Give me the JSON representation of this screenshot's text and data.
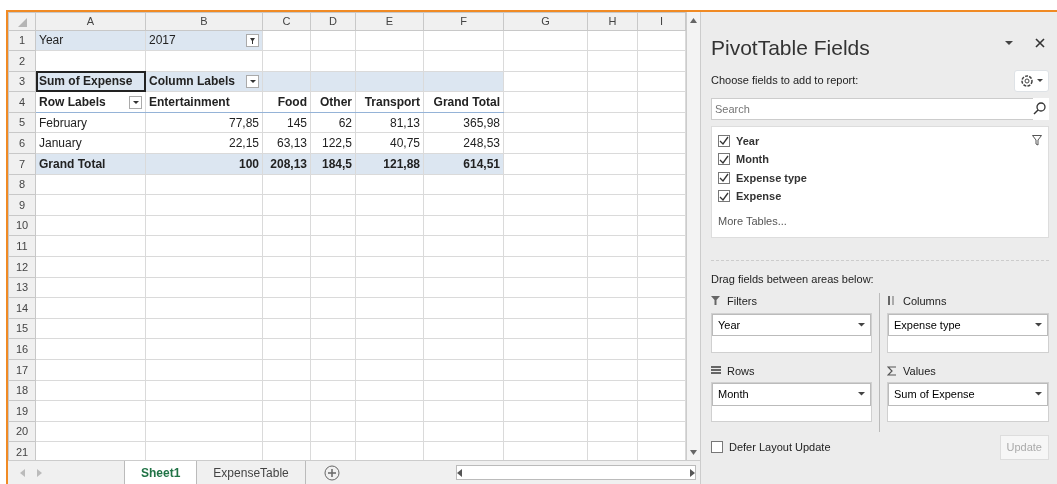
{
  "sheet": {
    "columns": [
      "A",
      "B",
      "C",
      "D",
      "E",
      "F",
      "G",
      "H",
      "I"
    ],
    "rows": [
      {
        "number": "1",
        "kind": "filter",
        "cells": [
          {
            "text": "Year",
            "selected": false
          },
          {
            "text": "2017",
            "selected": false,
            "kind": "filter-dropdown"
          }
        ]
      },
      {
        "number": "2",
        "kind": "blank"
      },
      {
        "number": "3",
        "kind": "caption",
        "cells": [
          {
            "text": "Sum of Expense",
            "selected": true
          },
          {
            "text": "Column Labels",
            "selected": false,
            "kind": "list-dropdown"
          }
        ]
      },
      {
        "number": "4",
        "kind": "header",
        "cells": [
          {
            "text": "Row Labels",
            "selected": false,
            "kind": "list-dropdown"
          },
          {
            "text": "Entertainment",
            "selected": false
          },
          {
            "text": "Food",
            "selected": false
          },
          {
            "text": "Other",
            "selected": false
          },
          {
            "text": "Transport",
            "selected": false
          },
          {
            "text": "Grand Total",
            "selected": false
          }
        ]
      },
      {
        "number": "5",
        "kind": "data",
        "cells": [
          {
            "text": "February",
            "selected": false
          },
          {
            "text": "77,85",
            "selected": false
          },
          {
            "text": "145",
            "selected": false
          },
          {
            "text": "62",
            "selected": false
          },
          {
            "text": "81,13",
            "selected": false
          },
          {
            "text": "365,98",
            "selected": false
          }
        ]
      },
      {
        "number": "6",
        "kind": "data",
        "cells": [
          {
            "text": "January",
            "selected": false
          },
          {
            "text": "22,15",
            "selected": false
          },
          {
            "text": "63,13",
            "selected": false
          },
          {
            "text": "122,5",
            "selected": false
          },
          {
            "text": "40,75",
            "selected": false
          },
          {
            "text": "248,53",
            "selected": false
          }
        ]
      },
      {
        "number": "7",
        "kind": "total",
        "cells": [
          {
            "text": "Grand Total",
            "selected": false
          },
          {
            "text": "100",
            "selected": false
          },
          {
            "text": "208,13",
            "selected": false
          },
          {
            "text": "184,5",
            "selected": false
          },
          {
            "text": "121,88",
            "selected": false
          },
          {
            "text": "614,51",
            "selected": false
          }
        ]
      },
      {
        "number": "8",
        "kind": "blank"
      },
      {
        "number": "9",
        "kind": "blank"
      },
      {
        "number": "10",
        "kind": "blank"
      },
      {
        "number": "11",
        "kind": "blank"
      },
      {
        "number": "12",
        "kind": "blank"
      },
      {
        "number": "13",
        "kind": "blank"
      },
      {
        "number": "14",
        "kind": "blank"
      },
      {
        "number": "15",
        "kind": "blank"
      },
      {
        "number": "16",
        "kind": "blank"
      },
      {
        "number": "17",
        "kind": "blank"
      },
      {
        "number": "18",
        "kind": "blank"
      },
      {
        "number": "19",
        "kind": "blank"
      },
      {
        "number": "20",
        "kind": "blank"
      },
      {
        "number": "21",
        "kind": "blank"
      }
    ],
    "tabs": [
      {
        "label": "Sheet1",
        "selected": true
      },
      {
        "label": "ExpenseTable",
        "selected": false
      }
    ]
  },
  "pane": {
    "title": "PivotTable Fields",
    "subtitle": "Choose fields to add to report:",
    "search": {
      "placeholder": "Search"
    },
    "fields": [
      {
        "label": "Year",
        "checked": true,
        "filtered": true
      },
      {
        "label": "Month",
        "checked": true,
        "filtered": false
      },
      {
        "label": "Expense type",
        "checked": true,
        "filtered": false
      },
      {
        "label": "Expense",
        "checked": true,
        "filtered": false
      }
    ],
    "more_tables": "More Tables...",
    "areas_hint": "Drag fields between areas below:",
    "areas": [
      {
        "kind": "filters",
        "label": "Filters",
        "items": [
          "Year"
        ]
      },
      {
        "kind": "columns",
        "label": "Columns",
        "items": [
          "Expense type"
        ]
      },
      {
        "kind": "rows",
        "label": "Rows",
        "items": [
          "Month"
        ]
      },
      {
        "kind": "values",
        "label": "Values",
        "items": [
          "Sum of Expense"
        ]
      }
    ],
    "defer": {
      "label": "Defer Layout Update",
      "checked": false
    },
    "update": {
      "label": "Update",
      "disabled": true
    }
  }
}
